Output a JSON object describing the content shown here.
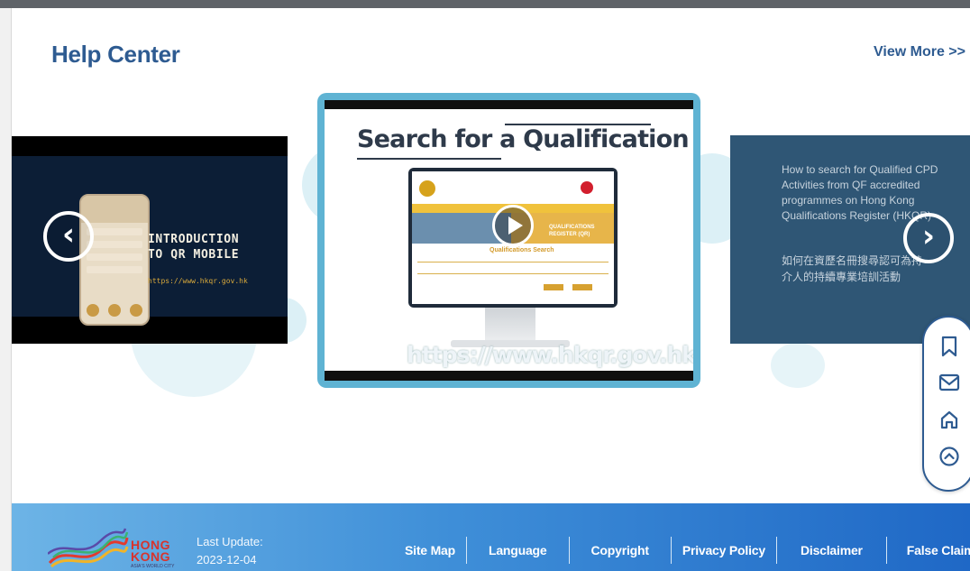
{
  "section": {
    "title": "Help Center",
    "view_more": "View More >>"
  },
  "carousel": {
    "left_slide": {
      "title_line1": "INTRODUCTION",
      "title_line2": "TO QR MOBILE",
      "url": "https://www.hkqr.gov.hk"
    },
    "center_slide": {
      "title": "Search for a Qualification",
      "screen_banner": "QUALIFICATIONS REGISTER (QR)",
      "screen_heading": "Qualifications Search",
      "url": "https://www.hkqr.gov.hk"
    },
    "right_slide": {
      "line1": "How to search for Qualified CPD",
      "line2": "Activities  from QF accredited",
      "line3": "programmes on Hong Kong",
      "line4": "Qualifications Register (HKQR)",
      "zh_line1": "如何在資歷名冊搜尋認可為持",
      "zh_line2": "介人的持續專業培訓活動"
    },
    "prev_glyph": "‹",
    "next_glyph": "›"
  },
  "toolbar": {
    "bookmark_icon": "bookmark-icon",
    "mail_icon": "mail-icon",
    "home_icon": "home-icon",
    "top_icon": "chevron-up-circle-icon"
  },
  "footer": {
    "logo_text_line1": "HONG",
    "logo_text_line2": "KONG",
    "logo_tagline": "ASIA'S WORLD CITY",
    "last_update_label": "Last Update:",
    "last_update_date": "2023-12-04",
    "links": [
      "Site Map",
      "Language",
      "Copyright",
      "Privacy Policy",
      "Disclaimer",
      "False Claims"
    ]
  },
  "colors": {
    "brand_blue": "#2e5b91",
    "slide_border": "#5fb3d3",
    "footer_start": "#6db4e6",
    "footer_end": "#1f68c6"
  }
}
